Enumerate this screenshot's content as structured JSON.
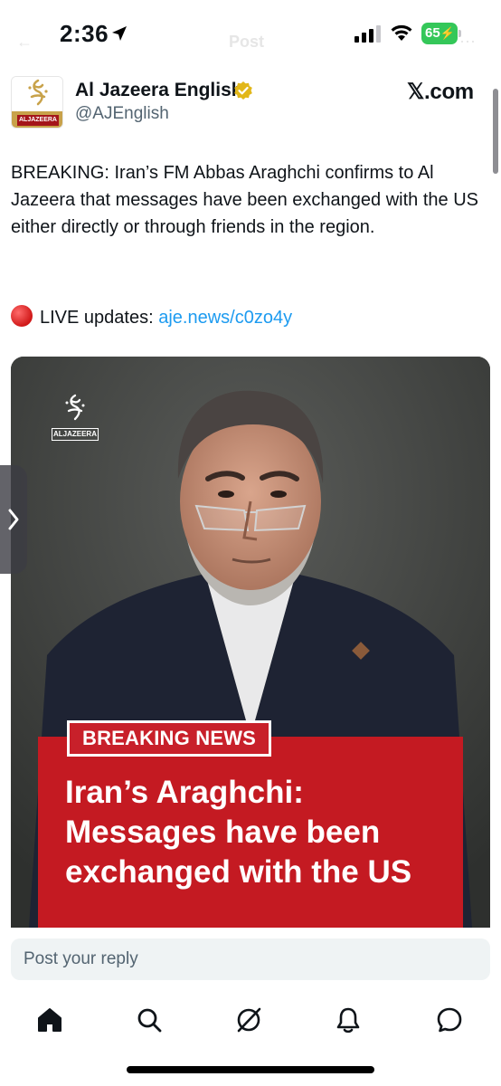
{
  "status_bar": {
    "time": "2:36",
    "battery": "65"
  },
  "ghost_header": {
    "back": "←",
    "title": "Post",
    "more": "⋯"
  },
  "tweet": {
    "author_name": "Al Jazeera English",
    "handle": "@AJEnglish",
    "source": "𝕏.com",
    "text": "BREAKING: Iran’s FM Abbas Araghchi confirms to Al Jazeera that messages have been exchanged with the US either directly or through friends in the region.",
    "live_prefix": "LIVE updates:",
    "live_link": "aje.news/c0zo4y",
    "avatar_label": "ALJAZEERA"
  },
  "media": {
    "logo_label": "ALJAZEERA",
    "badge": "BREAKING NEWS",
    "headline": "Iran’s Araghchi: Messages have been exchanged with the US"
  },
  "reply": {
    "placeholder": "Post your reply"
  },
  "nav": [
    {
      "icon": "home-icon"
    },
    {
      "icon": "search-icon"
    },
    {
      "icon": "grok-icon"
    },
    {
      "icon": "notifications-icon"
    },
    {
      "icon": "messages-icon"
    }
  ],
  "colors": {
    "link": "#1d9bf0",
    "breaking_red": "#c41a22",
    "battery_green": "#34c759"
  }
}
